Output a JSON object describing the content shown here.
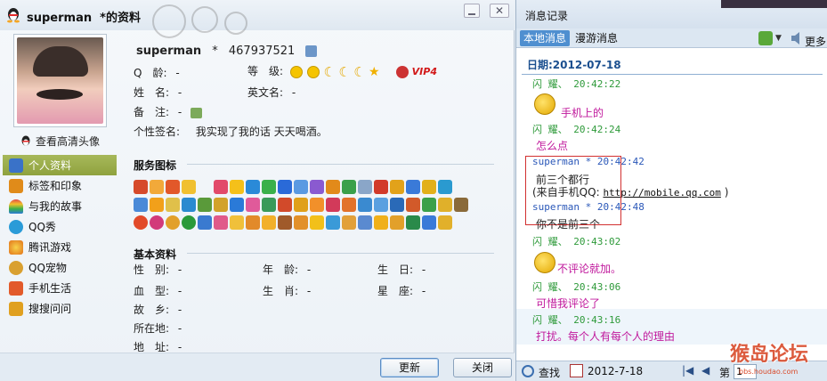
{
  "window": {
    "title": "superman  *的资料",
    "close_glyph": "✕"
  },
  "avatar": {
    "hd_link": "查看高清头像"
  },
  "nav": {
    "items": [
      {
        "label": "个人资料",
        "icon": "profile-card-icon",
        "color": "#3a72c8"
      },
      {
        "label": "标签和印象",
        "icon": "tag-icon",
        "color": "#e08b1a"
      },
      {
        "label": "与我的故事",
        "icon": "rainbow-icon",
        "color": "#e24a4a"
      },
      {
        "label": "QQ秀",
        "icon": "qqshow-icon",
        "color": "#2a9bd8"
      },
      {
        "label": "腾讯游戏",
        "icon": "game-icon",
        "color": "#f29a1a"
      },
      {
        "label": "QQ宠物",
        "icon": "pet-icon",
        "color": "#d9a030"
      },
      {
        "label": "手机生活",
        "icon": "phone-check-icon",
        "color": "#e25a2a"
      },
      {
        "label": "搜搜问问",
        "icon": "question-icon",
        "color": "#e0a020"
      }
    ]
  },
  "profile": {
    "name": "superman",
    "star": "*",
    "qq_number": "467937521",
    "q_age_label": "Q　龄:",
    "q_age_value": "-",
    "level_label": "等　级:",
    "vip_label": "VIP4",
    "name_label": "姓　名:",
    "name_value": "-",
    "en_name_label": "英文名:",
    "en_name_value": "-",
    "note_label": "备　注:",
    "note_value": "-",
    "signature_label": "个性签名:",
    "signature_value": "我实现了我的话 天天喝酒。"
  },
  "sections": {
    "service_icons": "服务图标",
    "basic_info": "基本资料"
  },
  "basic": {
    "gender_label": "性　别:",
    "gender_value": "-",
    "age_label": "年　龄:",
    "age_value": "-",
    "birthday_label": "生　日:",
    "birthday_value": "-",
    "blood_label": "血　型:",
    "blood_value": "-",
    "zodiac_label": "生　肖:",
    "zodiac_value": "-",
    "star_label": "星　座:",
    "star_value": "-",
    "hometown_label": "故　乡:",
    "hometown_value": "-",
    "location_label": "所在地:",
    "location_value": "-",
    "address_label": "地　址:",
    "address_value": "-"
  },
  "buttons": {
    "update": "更新",
    "close": "关闭"
  },
  "msg": {
    "title": "消息记录",
    "tab_local": "本地消息",
    "tab_roam": "漫游消息",
    "more": "更多",
    "date_heading": "日期:2012-07-18",
    "messages": [
      {
        "header": "闪 耀、 20:42:22",
        "text": "手机上的"
      },
      {
        "header": "闪 耀、 20:42:24",
        "text": "怎么点"
      },
      {
        "header": "superman * 20:42:42",
        "text": "前三个都行",
        "text2_prefix": "(来自手机QQ: ",
        "url": "http://mobile.qq.com",
        "text2_suffix": " )"
      },
      {
        "header": "superman * 20:42:48",
        "text": "你不是前三个"
      },
      {
        "header": "闪 耀、 20:43:02",
        "text": "不评论就加。"
      },
      {
        "header": "闪 耀、 20:43:06",
        "text": "可惜我评论了"
      },
      {
        "header": "闪 耀、 20:43:16",
        "text": "打扰。每个人有每个人的理由"
      }
    ],
    "search_label": "查找",
    "date_value": "2012-7-18",
    "page_label": "第",
    "page_value": "1",
    "watermark": "猴岛论坛",
    "watermark_sub": "bbs.houdao.com"
  }
}
